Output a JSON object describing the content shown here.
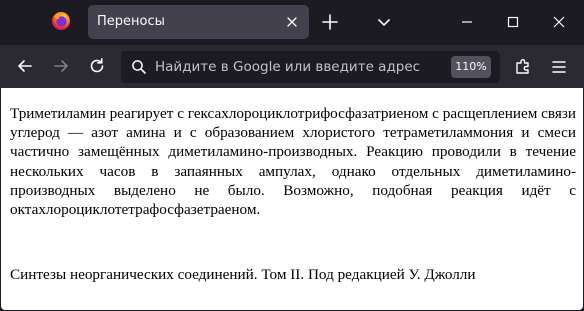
{
  "tab": {
    "title": "Переносы"
  },
  "urlbar": {
    "placeholder": "Найдите в Google или введите адрес",
    "zoom": "110%"
  },
  "icons": {
    "app_logo": "firefox-logo-icon",
    "tab_close": "close-icon",
    "new_tab": "plus-icon",
    "list_tabs": "chevron-down-icon",
    "minimize": "minimize-icon",
    "maximize": "maximize-icon",
    "close_window": "close-icon",
    "back": "arrow-left-icon",
    "forward": "arrow-right-icon",
    "reload": "reload-icon",
    "search": "search-icon",
    "extensions": "puzzle-icon",
    "menu": "hamburger-menu-icon"
  },
  "colors": {
    "titlebar": "#1c1b22",
    "active_tab": "#42414d",
    "toolbar": "#2b2a33",
    "urlbar": "#1c1b22",
    "page_background": "#ffffff"
  },
  "page": {
    "paragraph": "Триметиламин реагирует с гексахлороциклотрифосфазатриеном с расщеплением связи углерод — азот амина и с образованием хлористого тетраметиламмония и смеси частично замещённых диметиламино-производных. Реакцию проводили в течение нескольких часов в запаянных ампулах, однако отдельных диметиламино-производных выделено не было. Возможно, подобная реакция идёт с октахлороциклотетрафосфазетраеном.",
    "source": "Синтезы неорганических соединений. Том II. Под редакцией У. Джолли"
  }
}
